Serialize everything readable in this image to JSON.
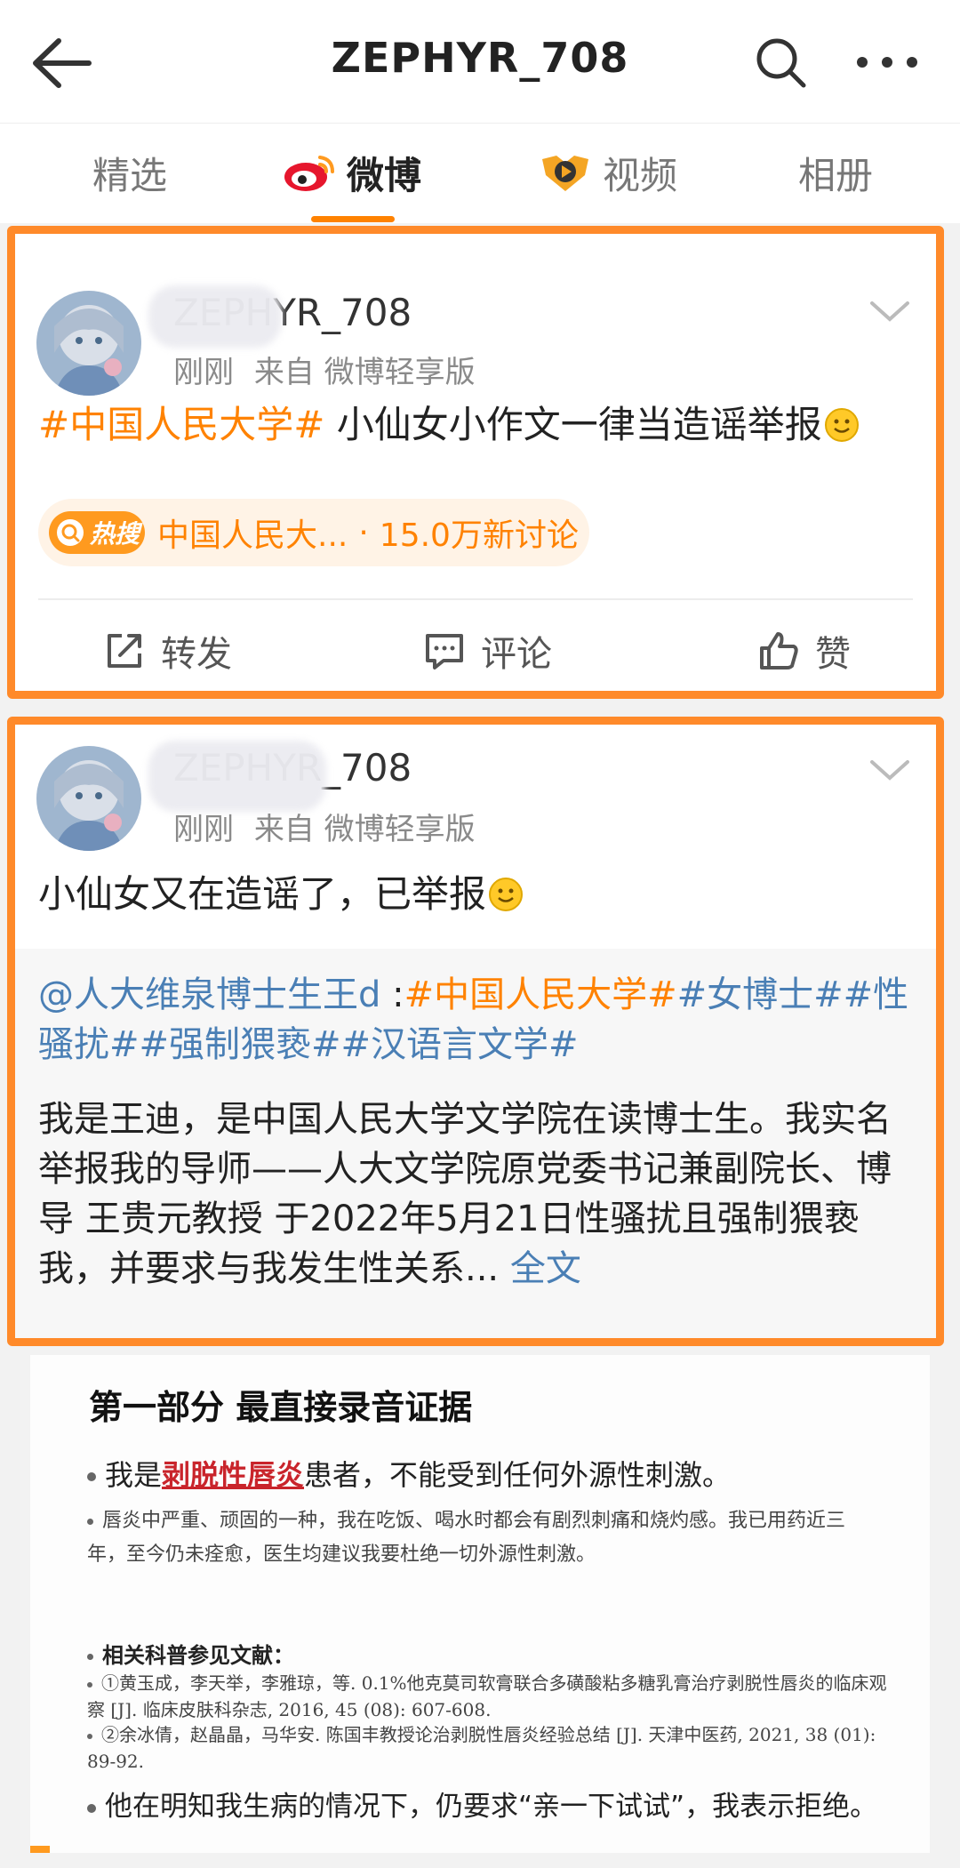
{
  "header": {
    "title": "ZEPHYR_708",
    "back_icon": "arrow-left-icon",
    "search_icon": "search-icon",
    "more_icon": "more-dots-icon"
  },
  "tabs": [
    {
      "label": "精选",
      "active": false
    },
    {
      "label": "微博",
      "active": true,
      "icon": "weibo-logo-icon"
    },
    {
      "label": "视频",
      "active": false,
      "icon": "video-badge-icon"
    },
    {
      "label": "相册",
      "active": false
    }
  ],
  "accent_color": "#ff8200",
  "highlight_border_color": "#ff8a2a",
  "posts": [
    {
      "username": "ZEPHYR_708",
      "time": "刚刚",
      "source": "来自 微博轻享版",
      "text_topic": "#中国人民大学#",
      "text_body": " 小仙女小作文一律当造谣举报",
      "hot": {
        "badge": "热搜",
        "name": "中国人民大...",
        "sep": "·",
        "count": "15.0万新讨论"
      },
      "actions": {
        "repost": "转发",
        "comment": "评论",
        "like": "赞"
      }
    },
    {
      "username": "ZEPHYR_708",
      "time": "刚刚",
      "source": "来自 微博轻享版",
      "text_body": "小仙女又在造谣了，已举报",
      "repost": {
        "mention": "@人大维泉博士生王d",
        "colon": " :",
        "topic1": "#中国人民大学#",
        "topic2": "#女博士#",
        "topic3": "#性骚扰#",
        "topic4": "#强制猥亵#",
        "topic5": "#汉语言文学#",
        "body": "我是王迪，是中国人民大学文学院在读博士生。我实名举报我的导师——人大文学院原党委书记兼副院长、博导 王贵元教授 于2022年5月21日性骚扰且强制猥亵我，并要求与我发生性关系...",
        "more": "全文"
      }
    }
  ],
  "document": {
    "heading": "第一部分  最直接录音证据",
    "bullet1_pre": "我是",
    "bullet1_hl": "剥脱性唇炎",
    "bullet1_post": "患者，不能受到任何外源性刺激。",
    "para1": "唇炎中严重、顽固的一种，我在吃饭、喝水时都会有剧烈刺痛和烧灼感。我已用药近三年，至今仍未痊愈，医生均建议我要杜绝一切外源性刺激。",
    "ref_title": "相关科普参见文献：",
    "ref1": "①黄玉成，李天举，李雅琼，等. 0.1%他克莫司软膏联合多磺酸粘多糖乳膏治疗剥脱性唇炎的临床观察 [J]. 临床皮肤科杂志, 2016, 45 (08): 607-608.",
    "ref2": "②余冰倩，赵晶晶，马华安. 陈国丰教授论治剥脱性唇炎经验总结 [J]. 天津中医药, 2021, 38 (01): 89-92.",
    "bullet2": "他在明知我生病的情况下，仍要求“亲一下试试”，我表示拒绝。"
  }
}
